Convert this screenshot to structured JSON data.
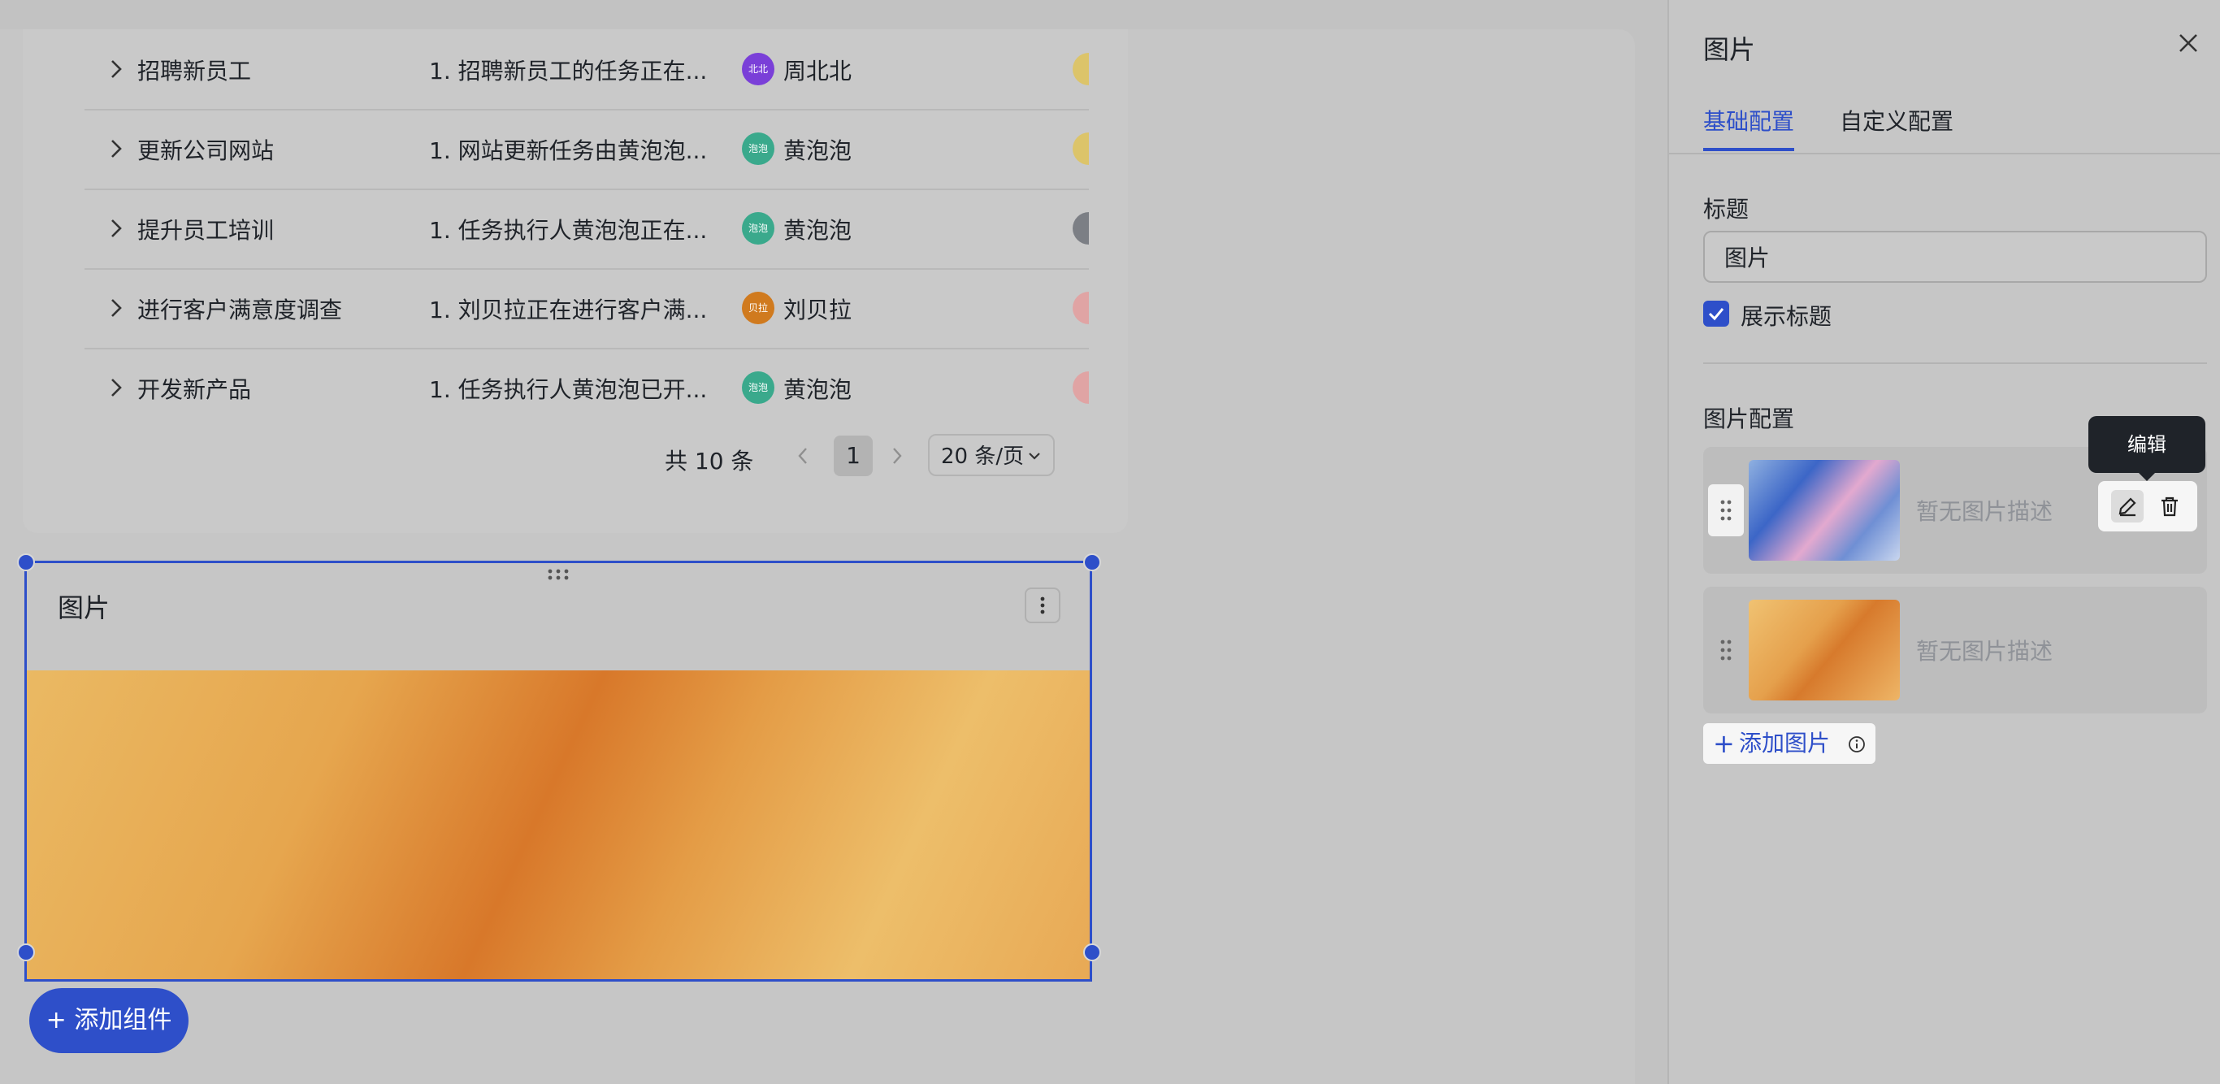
{
  "table": {
    "rows": [
      {
        "name": "招聘新员工",
        "desc": "1. 招聘新员工的任务正在...",
        "avatar": "北北",
        "avatar_color": "#7a3fd8",
        "person": "周北北",
        "tag_color": "#dcc46a"
      },
      {
        "name": "更新公司网站",
        "desc": "1. 网站更新任务由黄泡泡...",
        "avatar": "泡泡",
        "avatar_color": "#3aa98c",
        "person": "黄泡泡",
        "tag_color": "#dcc46a"
      },
      {
        "name": "提升员工培训",
        "desc": "1. 任务执行人黄泡泡正在...",
        "avatar": "泡泡",
        "avatar_color": "#3aa98c",
        "person": "黄泡泡",
        "tag_color": "#7c7f85"
      },
      {
        "name": "进行客户满意度调查",
        "desc": "1. 刘贝拉正在进行客户满...",
        "avatar": "贝拉",
        "avatar_color": "#d07a1e",
        "person": "刘贝拉",
        "tag_color": "#e0a4a4"
      },
      {
        "name": "开发新产品",
        "desc": "1. 任务执行人黄泡泡已开...",
        "avatar": "泡泡",
        "avatar_color": "#3aa98c",
        "person": "黄泡泡",
        "tag_color": "#e0a4a4"
      }
    ],
    "pagination": {
      "total": "共 10 条",
      "current_page": "1",
      "page_size": "20 条/页"
    }
  },
  "image_widget": {
    "title": "图片"
  },
  "add_component_label": "+ 添加组件",
  "side_panel": {
    "title": "图片",
    "tabs": [
      "基础配置",
      "自定义配置"
    ],
    "active_tab": "基础配置",
    "title_label": "标题",
    "title_value": "图片",
    "show_title_label": "展示标题",
    "show_title_checked": true,
    "image_config_label": "图片配置",
    "images": [
      {
        "desc": "暂无图片描述",
        "thumb": "blue"
      },
      {
        "desc": "暂无图片描述",
        "thumb": "orange"
      }
    ],
    "tooltip": "编辑",
    "add_image_label": "添加图片"
  },
  "colors": {
    "accent": "#2e4fc9",
    "overlay": "#c6c6c6"
  },
  "icons": [
    "chevron-right-icon",
    "chevron-left-icon",
    "chevron-down-icon",
    "drag-dots-icon",
    "more-vertical-icon",
    "close-icon",
    "check-icon",
    "grip-icon",
    "edit-icon",
    "trash-icon",
    "plus-icon",
    "info-icon"
  ]
}
